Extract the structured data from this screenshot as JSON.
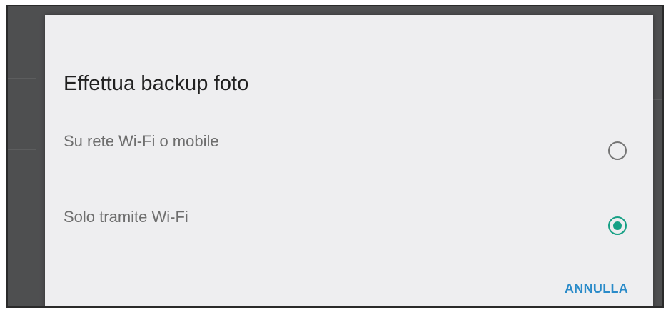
{
  "dialog": {
    "title": "Effettua backup foto",
    "options": [
      {
        "label": "Su rete Wi-Fi o mobile",
        "selected": false
      },
      {
        "label": "Solo tramite Wi-Fi",
        "selected": true
      }
    ],
    "cancel_label": "ANNULLA"
  },
  "colors": {
    "accent": "#16a085",
    "button": "#2a8bc9",
    "dialog_bg": "#eeeef0",
    "backdrop": "#4e4f50"
  }
}
